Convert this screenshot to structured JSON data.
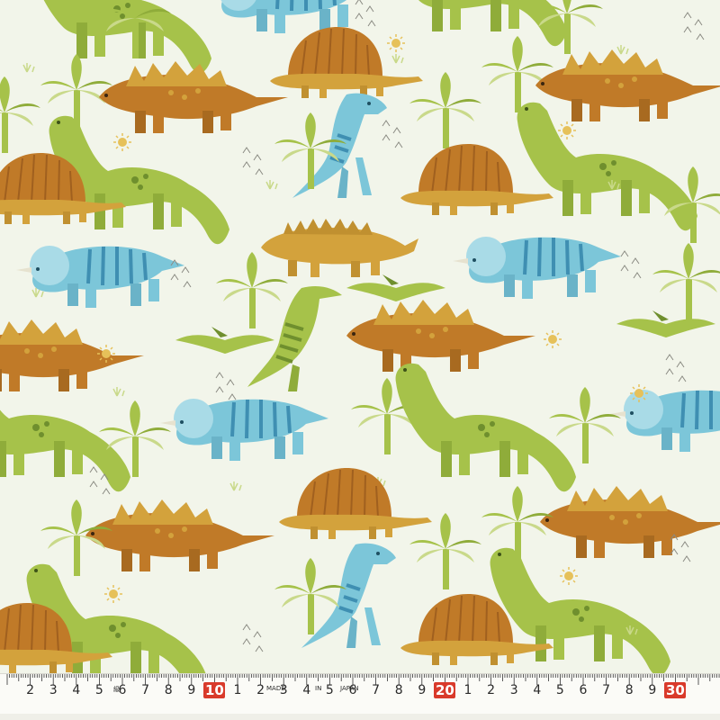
{
  "description_free": true,
  "palette": {
    "background": "#f2f5ea",
    "green": "#a6c24a",
    "green_dark": "#6f8f2e",
    "orange": "#c07a28",
    "orange_light": "#d3a23c",
    "blue": "#7cc6d9",
    "blue_dark": "#3f8fb2",
    "leaf": "#c9d98a"
  },
  "motifs": [
    "brachiosaurus",
    "stegosaurus",
    "dimetrodon",
    "t-rex",
    "triceratops",
    "ankylosaurus",
    "parasaurolophus",
    "pterodactyl",
    "palm-tree",
    "sun",
    "footprints"
  ],
  "ruler": {
    "numbers_small": [
      "2",
      "3",
      "4",
      "5",
      "6",
      "7",
      "8",
      "9",
      "1",
      "2",
      "3",
      "4",
      "5",
      "6",
      "7",
      "8",
      "9",
      "1",
      "2",
      "3",
      "4",
      "5",
      "6",
      "7",
      "8",
      "9"
    ],
    "marks": [
      "10",
      "20",
      "30"
    ],
    "print_marks": [
      "MADE",
      "IN",
      "JAPAN",
      "級"
    ]
  }
}
